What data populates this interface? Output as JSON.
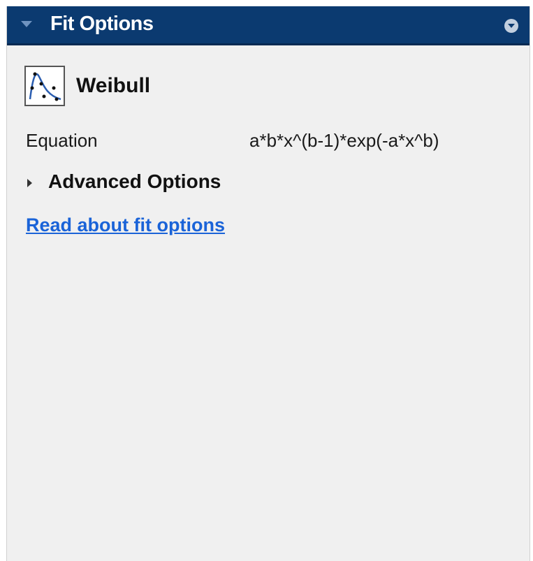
{
  "panel": {
    "title": "Fit Options",
    "collapse_icon": "chevron-down-icon",
    "options_icon": "circle-chevron-down-icon"
  },
  "fit": {
    "icon": "weibull-curve-icon",
    "name": "Weibull"
  },
  "equation": {
    "label": "Equation",
    "value": "a*b*x^(b-1)*exp(-a*x^b)"
  },
  "advanced": {
    "label": "Advanced Options",
    "expanded": false
  },
  "help_link": {
    "label": "Read about fit options"
  },
  "colors": {
    "title_bar": "#0b3a70",
    "panel_bg": "#f0f0f0",
    "link": "#1a63d8"
  }
}
